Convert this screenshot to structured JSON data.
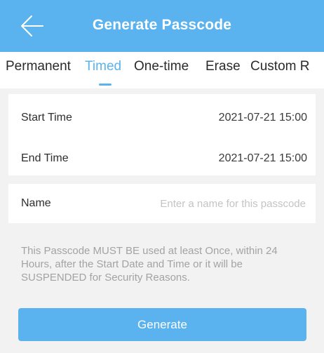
{
  "header": {
    "title": "Generate Passcode",
    "back_icon": "arrow-left-icon"
  },
  "tabs": [
    {
      "label": "Permanent",
      "active": false
    },
    {
      "label": "Timed",
      "active": true
    },
    {
      "label": "One-time",
      "active": false
    },
    {
      "label": "Erase",
      "active": false
    },
    {
      "label": "Custom R",
      "active": false
    }
  ],
  "time_settings": {
    "start_label": "Start Time",
    "start_value": "2021-07-21 15:00",
    "end_label": "End Time",
    "end_value": "2021-07-21 15:00"
  },
  "name_field": {
    "label": "Name",
    "value": "",
    "placeholder": "Enter a name for this passcode"
  },
  "notice": "This Passcode MUST BE used at least Once, within 24 Hours, after the Start Date and Time or it will be SUSPENDED for Security Reasons.",
  "generate_button": {
    "label": "Generate"
  },
  "colors": {
    "accent": "#5ab3ef",
    "background": "#f2f2f2",
    "notice_text": "#a3a3a3"
  }
}
